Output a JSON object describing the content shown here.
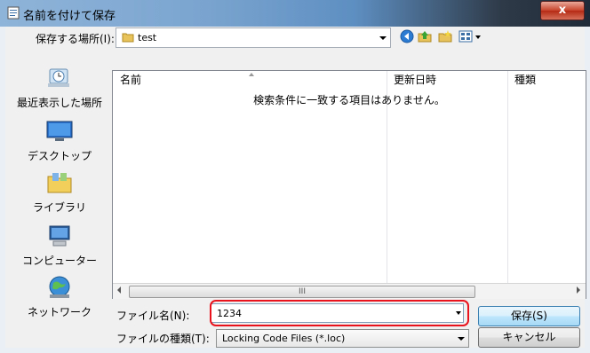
{
  "window": {
    "title": "名前を付けて保存",
    "close_glyph": "x"
  },
  "location": {
    "label": "保存する場所(I):",
    "value": "test"
  },
  "places": [
    {
      "label": "最近表示した場所",
      "icon": "recent-places-icon"
    },
    {
      "label": "デスクトップ",
      "icon": "desktop-icon"
    },
    {
      "label": "ライブラリ",
      "icon": "libraries-icon"
    },
    {
      "label": "コンピューター",
      "icon": "computer-icon"
    },
    {
      "label": "ネットワーク",
      "icon": "network-icon"
    }
  ],
  "file_list": {
    "columns": [
      "名前",
      "更新日時",
      "種類"
    ],
    "empty_message": "検索条件に一致する項目はありません。",
    "scroll_grip": "III"
  },
  "filename": {
    "label": "ファイル名(N):",
    "value": "1234"
  },
  "filetype": {
    "label": "ファイルの種類(T):",
    "value": "Locking Code Files (*.loc)"
  },
  "buttons": {
    "save": "保存(S)",
    "cancel": "キャンセル"
  },
  "colors": {
    "highlight_outline": "#e8131d",
    "default_button": "#3c7fb1"
  }
}
